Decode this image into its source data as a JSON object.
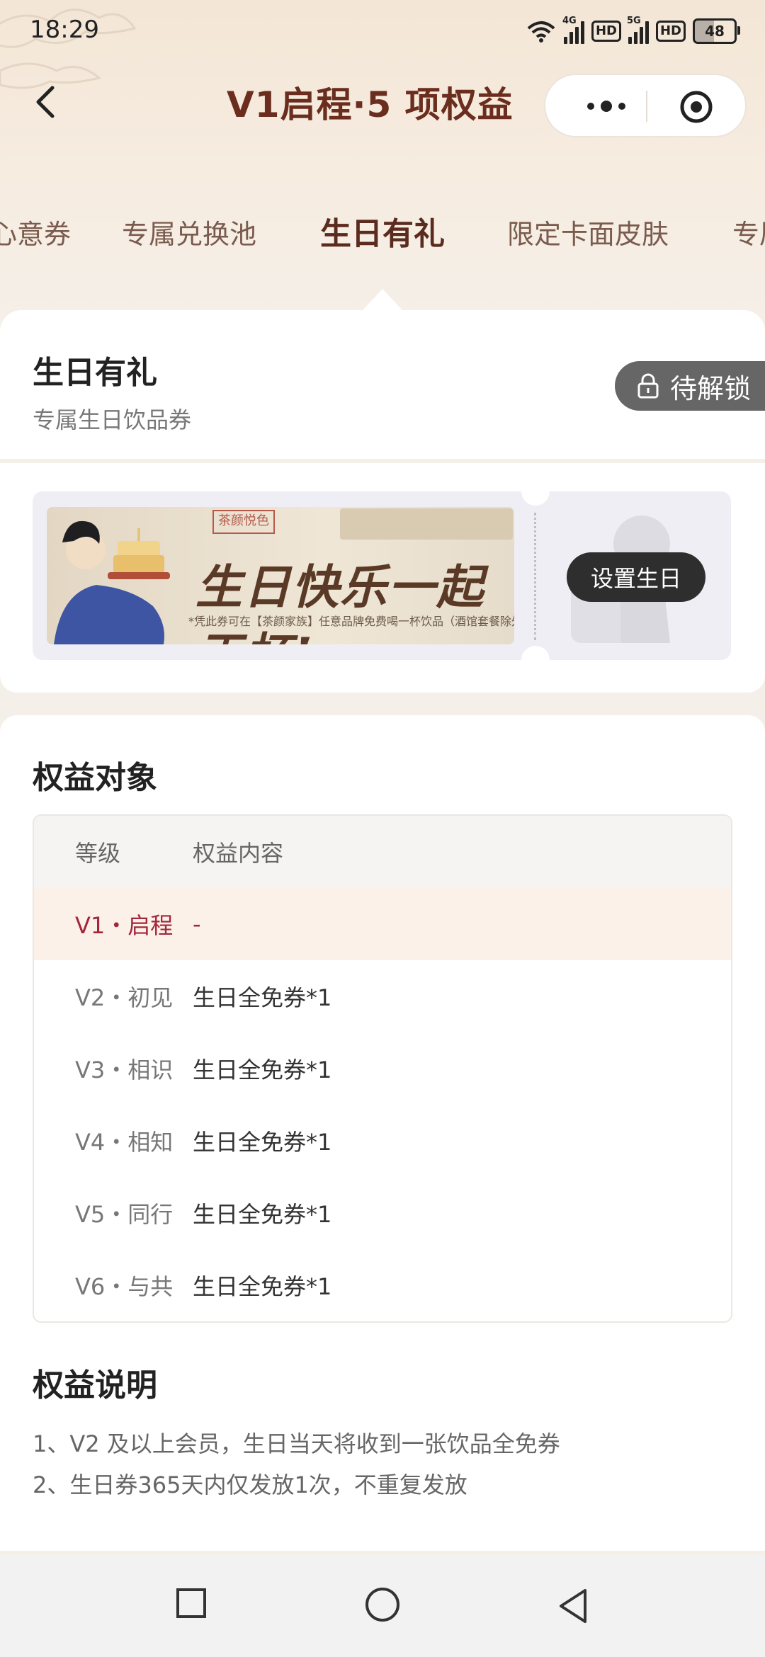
{
  "status_bar": {
    "time": "18:29",
    "sig1_tag": "4G",
    "sig2_tag": "5G",
    "hd1": "HD",
    "hd2": "HD",
    "battery": "48"
  },
  "header": {
    "title": "V1启程·5 项权益",
    "back_icon": "chevron-left-icon",
    "more_icon": "more-dots-icon",
    "close_icon": "target-icon"
  },
  "tabs": [
    {
      "label": "心意券",
      "active": false
    },
    {
      "label": "专属兑换池",
      "active": false
    },
    {
      "label": "生日有礼",
      "active": true
    },
    {
      "label": "限定卡面皮肤",
      "active": false
    },
    {
      "label": "专属",
      "active": false
    }
  ],
  "benefit": {
    "title": "生日有礼",
    "subtitle": "专属生日饮品券",
    "lock_label": "待解锁",
    "coupon": {
      "banner_headline": "生日快乐一起干杯!",
      "banner_stamp": "茶颜悦色",
      "banner_fine_print": "*凭此券可在【茶颜家族】任意品牌免费喝一杯饮品（酒馆套餐除外）",
      "action_label": "设置生日"
    }
  },
  "eligibility": {
    "title": "权益对象",
    "headers": [
      "等级",
      "权益内容"
    ],
    "rows": [
      {
        "level": "V1・启程",
        "content": "-",
        "highlight": true
      },
      {
        "level": "V2・初见",
        "content": "生日全免券*1",
        "highlight": false
      },
      {
        "level": "V3・相识",
        "content": "生日全免券*1",
        "highlight": false
      },
      {
        "level": "V4・相知",
        "content": "生日全免券*1",
        "highlight": false
      },
      {
        "level": "V5・同行",
        "content": "生日全免券*1",
        "highlight": false
      },
      {
        "level": "V6・与共",
        "content": "生日全免券*1",
        "highlight": false
      }
    ]
  },
  "notes": {
    "title": "权益说明",
    "items": [
      "1、V2 及以上会员，生日当天将收到一张饮品全免券",
      "2、生日券365天内仅发放1次，不重复发放"
    ]
  },
  "colors": {
    "title_brown": "#6b2e1e",
    "highlight_red": "#a3263a",
    "highlight_bg": "#fbf1e9",
    "page_bg": "#f4efe8"
  },
  "nav": {
    "recent_icon": "square-icon",
    "home_icon": "circle-icon",
    "back_icon": "triangle-back-icon"
  }
}
